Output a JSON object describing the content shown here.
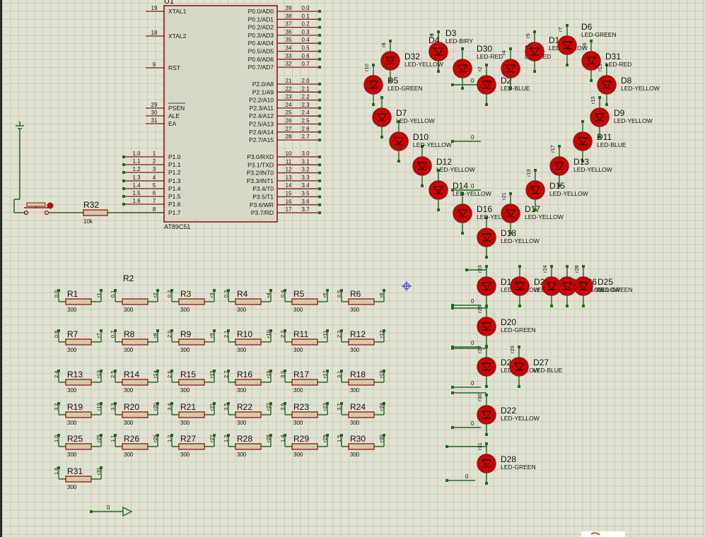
{
  "chip": {
    "ref": "U1",
    "part": "AT89C51",
    "left_pins": [
      {
        "num": "19",
        "name": "XTAL1"
      },
      {
        "num": "18",
        "name": "XTAL2"
      },
      {
        "num": "9",
        "name": "RST"
      },
      {
        "num": "29",
        "name": "PSEN"
      },
      {
        "num": "30",
        "name": "ALE"
      },
      {
        "num": "31",
        "name": "EA"
      },
      {
        "num": "1",
        "name": "P1.0",
        "net": "1.0"
      },
      {
        "num": "2",
        "name": "P1.1",
        "net": "1.1"
      },
      {
        "num": "3",
        "name": "P1.2",
        "net": "1.2"
      },
      {
        "num": "4",
        "name": "P1.3",
        "net": "1.3"
      },
      {
        "num": "5",
        "name": "P1.4",
        "net": "1.4"
      },
      {
        "num": "6",
        "name": "P1.5",
        "net": "1.5"
      },
      {
        "num": "7",
        "name": "P1.6",
        "net": "1.6"
      },
      {
        "num": "8",
        "name": "P1.7"
      }
    ],
    "right_pins": [
      {
        "num": "39",
        "name": "P0.0/AD0",
        "net": "0.0"
      },
      {
        "num": "38",
        "name": "P0.1/AD1",
        "net": "0.1"
      },
      {
        "num": "37",
        "name": "P0.2/AD2",
        "net": "0.2"
      },
      {
        "num": "36",
        "name": "P0.3/AD3",
        "net": "0.3"
      },
      {
        "num": "35",
        "name": "P0.4/AD4",
        "net": "0.4"
      },
      {
        "num": "34",
        "name": "P0.5/AD5",
        "net": "0.5"
      },
      {
        "num": "33",
        "name": "P0.6/AD6",
        "net": "0.6"
      },
      {
        "num": "32",
        "name": "P0.7/AD7",
        "net": "0.7"
      },
      {
        "num": "21",
        "name": "P2.0/A8",
        "net": "2.0"
      },
      {
        "num": "22",
        "name": "P2.1/A9",
        "net": "2.1"
      },
      {
        "num": "23",
        "name": "P2.2/A10",
        "net": "2.2"
      },
      {
        "num": "24",
        "name": "P2.3/A11",
        "net": "2.3"
      },
      {
        "num": "25",
        "name": "P2.4/A12",
        "net": "2.4"
      },
      {
        "num": "26",
        "name": "P2.5/A13",
        "net": "2.5"
      },
      {
        "num": "27",
        "name": "P2.6/A14",
        "net": "2.6"
      },
      {
        "num": "28",
        "name": "P2.7/A15",
        "net": "2.7"
      },
      {
        "num": "10",
        "name": "P3.0/RXD",
        "net": "3.0"
      },
      {
        "num": "11",
        "name": "P3.1/TXD",
        "net": "3.1"
      },
      {
        "num": "12",
        "name": "P3.2/INT0",
        "net": "3.2"
      },
      {
        "num": "13",
        "name": "P3.3/INT1",
        "net": "3.3"
      },
      {
        "num": "14",
        "name": "P3.4/T0",
        "net": "3.4"
      },
      {
        "num": "15",
        "name": "P3.5/T1",
        "net": "3.5"
      },
      {
        "num": "16",
        "name": "P3.6/WR",
        "net": "3.6"
      },
      {
        "num": "17",
        "name": "P3.7/RD",
        "net": "3.7"
      }
    ]
  },
  "r32": {
    "ref": "R32",
    "value": "10k"
  },
  "r2_title": "R2",
  "resistors": [
    {
      "ref": "R1",
      "value": "300",
      "in": "0.0",
      "out": "r1"
    },
    {
      "ref": "",
      "value": "300",
      "in": "0.1",
      "out": "r2"
    },
    {
      "ref": "R3",
      "value": "300",
      "in": "0.2",
      "out": "r3"
    },
    {
      "ref": "R4",
      "value": "300",
      "in": "0.3",
      "out": "r4"
    },
    {
      "ref": "R5",
      "value": "300",
      "in": "0.4",
      "out": "r5"
    },
    {
      "ref": "R6",
      "value": "300",
      "in": "0.5",
      "out": "r6"
    },
    {
      "ref": "R7",
      "value": "300",
      "in": "0.6",
      "out": "r7"
    },
    {
      "ref": "R8",
      "value": "300",
      "in": "0.7",
      "out": "r8"
    },
    {
      "ref": "R9",
      "value": "300",
      "in": "2.0",
      "out": "r9"
    },
    {
      "ref": "R10",
      "value": "300",
      "in": "2.1",
      "out": "r10"
    },
    {
      "ref": "R11",
      "value": "300",
      "in": "2.2",
      "out": "r11"
    },
    {
      "ref": "R12",
      "value": "300",
      "in": "2.3",
      "out": "r12"
    },
    {
      "ref": "R13",
      "value": "300",
      "in": "2.4",
      "out": "r13"
    },
    {
      "ref": "R14",
      "value": "300",
      "in": "2.5",
      "out": "r14"
    },
    {
      "ref": "R15",
      "value": "300",
      "in": "2.6",
      "out": "r15"
    },
    {
      "ref": "R16",
      "value": "300",
      "in": "2.7",
      "out": "r16"
    },
    {
      "ref": "R17",
      "value": "300",
      "in": "3.0",
      "out": "r17"
    },
    {
      "ref": "R18",
      "value": "300",
      "in": "3.1",
      "out": "r18"
    },
    {
      "ref": "R19",
      "value": "300",
      "in": "3.2",
      "out": "r19"
    },
    {
      "ref": "R20",
      "value": "300",
      "in": "3.3",
      "out": "r20"
    },
    {
      "ref": "R21",
      "value": "300",
      "in": "3.4",
      "out": "r21"
    },
    {
      "ref": "R22",
      "value": "300",
      "in": "3.5",
      "out": "r22"
    },
    {
      "ref": "R23",
      "value": "300",
      "in": "3.6",
      "out": "r23"
    },
    {
      "ref": "R24",
      "value": "300",
      "in": "3.7",
      "out": "r24"
    },
    {
      "ref": "R25",
      "value": "300",
      "in": "1.0",
      "out": "r25"
    },
    {
      "ref": "R26",
      "value": "300",
      "in": "1.1",
      "out": "r26"
    },
    {
      "ref": "R27",
      "value": "300",
      "in": "1.2",
      "out": "r27"
    },
    {
      "ref": "R28",
      "value": "300",
      "in": "1.3",
      "out": "r28"
    },
    {
      "ref": "R29",
      "value": "300",
      "in": "1.4",
      "out": "r29"
    },
    {
      "ref": "R30",
      "value": "300",
      "in": "1.5",
      "out": "r30"
    },
    {
      "ref": "R31",
      "value": "300",
      "in": "1.6",
      "out": "r31"
    }
  ],
  "leds": [
    {
      "ref": "D5",
      "type": "LED-GREEN",
      "net": "r10"
    },
    {
      "ref": "D32",
      "type": "LED-YELLOW",
      "net": "r8"
    },
    {
      "ref": "D4",
      "type": "",
      "net": "r9"
    },
    {
      "ref": "D3",
      "type": "LED-BIRY",
      "net": "r3"
    },
    {
      "ref": "D30",
      "type": "LED-RED",
      "net": ""
    },
    {
      "ref": "D2",
      "type": "LED-BLUE",
      "net": "r2"
    },
    {
      "ref": "D29",
      "type": "LED-RED",
      "net": "r4"
    },
    {
      "ref": "D1",
      "type": "LED-YELLOW",
      "net": "r5"
    },
    {
      "ref": "D6",
      "type": "LED-GREEN",
      "net": "r7"
    },
    {
      "ref": "D31",
      "type": "LED-RED",
      "net": "r6"
    },
    {
      "ref": "D8",
      "type": "LED-YELLOW",
      "net": "r13"
    },
    {
      "ref": "D7",
      "type": "LED-YELLOW",
      "net": ""
    },
    {
      "ref": "D9",
      "type": "LED-YELLOW",
      "net": "r15"
    },
    {
      "ref": "D10",
      "type": "LED-YELLOW",
      "net": ""
    },
    {
      "ref": "D11",
      "type": "LED-BLUE",
      "net": ""
    },
    {
      "ref": "D12",
      "type": "LED-YELLOW",
      "net": ""
    },
    {
      "ref": "D13",
      "type": "LED-YELLOW",
      "net": "r17"
    },
    {
      "ref": "D14",
      "type": "LED-YELLOW",
      "net": ""
    },
    {
      "ref": "D15",
      "type": "LED-YELLOW",
      "net": "r19"
    },
    {
      "ref": "D16",
      "type": "LED-YELLOW",
      "net": ""
    },
    {
      "ref": "D17",
      "type": "LED-YELLOW",
      "net": "r21"
    },
    {
      "ref": "D18",
      "type": "LED-YELLOW",
      "net": ""
    },
    {
      "ref": "D19",
      "type": "LED-YELLOW",
      "net": "r23"
    },
    {
      "ref": "D23",
      "type": "LED-YELLOW",
      "net": ""
    },
    {
      "ref": "D24",
      "type": "LED-YELLOW",
      "net": "r24"
    },
    {
      "ref": "D26",
      "type": "LED-YELLOW",
      "net": ""
    },
    {
      "ref": "D25",
      "type": "LED-GREEN",
      "net": "r28"
    },
    {
      "ref": "D20",
      "type": "LED-GREEN",
      "net": "r25"
    },
    {
      "ref": "D21",
      "type": "LED-YELLOW",
      "net": "r27"
    },
    {
      "ref": "D27",
      "type": "LED-BLUE",
      "net": "r29"
    },
    {
      "ref": "D22",
      "type": "LED-YELLOW",
      "net": "r30"
    },
    {
      "ref": "D28",
      "type": "LED-GREEN",
      "net": "r31"
    }
  ],
  "ground_label": "0",
  "bottom_net": "0",
  "colors": {
    "wire": "#1e6b1e",
    "component": "#8b1a1a",
    "chip_fill": "#d8d8c8",
    "resistor_fill": "#d8c8a8",
    "led_fill": "#cc0000",
    "text": "#111111",
    "pin_dot": "#1e6b1e"
  }
}
